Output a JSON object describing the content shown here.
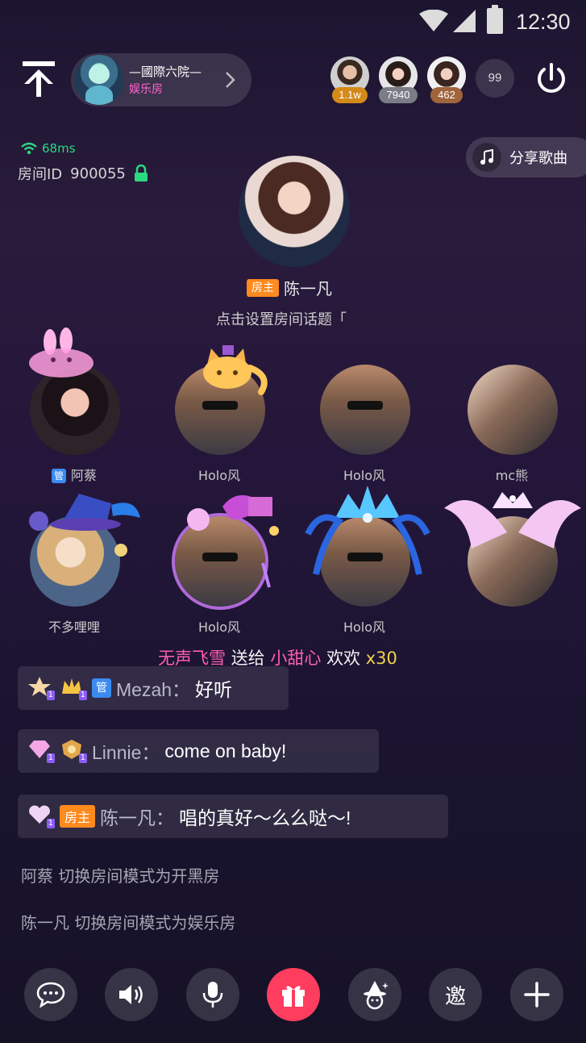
{
  "status_bar": {
    "time": "12:30"
  },
  "header": {
    "room_name": "—國際六院—",
    "room_type": "娱乐房",
    "viewers": [
      {
        "count": "1.1w",
        "badge_color": "#d48a1a"
      },
      {
        "count": "7940",
        "badge_color": "#7b7d86"
      },
      {
        "count": "462",
        "badge_color": "#a0643c"
      }
    ],
    "online_count": "99"
  },
  "info": {
    "ping": "68ms",
    "room_id_label": "房间ID",
    "room_id": "900055"
  },
  "share_song": {
    "label": "分享歌曲"
  },
  "host": {
    "tag": "房主",
    "name": "陈一凡",
    "topic": "点击设置房间话题「"
  },
  "seats": [
    {
      "name": "阿蔡",
      "manager_tag": "管"
    },
    {
      "name": "Holo风"
    },
    {
      "name": "Holo风"
    },
    {
      "name": "mc熊"
    },
    {
      "name": "不多哩哩"
    },
    {
      "name": "Holo风"
    },
    {
      "name": "Holo风"
    },
    {
      "name": ""
    }
  ],
  "gift_banner": {
    "sender": "无声飞雪",
    "verb": "送给",
    "receiver": "小甜心",
    "gift": "欢欢",
    "count": "x30"
  },
  "chat": [
    {
      "user": "Mezah：",
      "msg": "好听",
      "manager_tag": "管",
      "level": "1"
    },
    {
      "user": "Linnie：",
      "msg": "come on baby!",
      "level": "1"
    },
    {
      "user": "陈一凡：",
      "msg": "唱的真好～么么哒～!",
      "owner_tag": "房主",
      "level": "1"
    }
  ],
  "system_messages": [
    "阿蔡 切换房间模式为开黑房",
    "陈一凡 切换房间模式为娱乐房"
  ],
  "bottom_bar": {
    "invite_label": "邀"
  },
  "colors": {
    "accent_pink": "#ff5fae",
    "gift_red": "#ff3d5f",
    "ping_green": "#2bd980",
    "owner_orange": "#ff8a1e",
    "manager_blue": "#3b8af0"
  }
}
